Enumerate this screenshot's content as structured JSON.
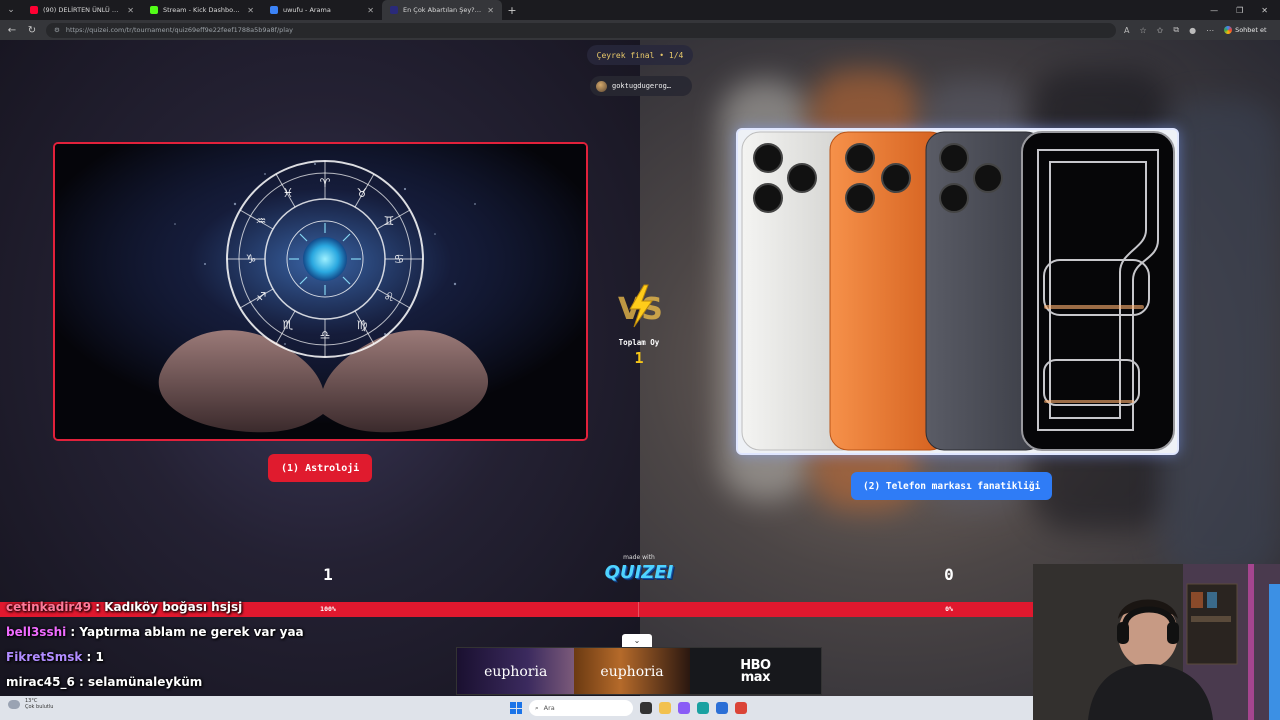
{
  "browser": {
    "tabs": [
      {
        "title": "(90) DELİRTEN ÜNLÜ BİLME OYUN",
        "favicon_color": "#ff0033",
        "active": false
      },
      {
        "title": "Stream - Kick Dashboard",
        "favicon_color": "#53fc18",
        "active": false
      },
      {
        "title": "uwufu - Arama",
        "favicon_color": "#3b82f6",
        "active": false
      },
      {
        "title": "En Çok Abartılan Şey?#2 - Tier Lis",
        "favicon_color": "#2a2a7a",
        "active": true
      }
    ],
    "url": "https://quizei.com/tr/tournament/quiz69eff9e22feef1788a5b9a8f/play",
    "chat_button": "Sohbet et"
  },
  "quiz": {
    "round_badge": "Çeyrek final • 1/4",
    "creator": "goktugdugerog…",
    "left_option": {
      "label": "(1) Astroloji",
      "score": "1",
      "percent": "100%",
      "ratio": 1.0
    },
    "right_option": {
      "label": "(2) Telefon markası fanatikliği",
      "score": "0",
      "percent": "0%",
      "ratio": 0.0
    },
    "vs_text": "VS",
    "total_label": "Toplam Oy",
    "total_value": "1",
    "made_with": "made with",
    "logo": "QUIZEI",
    "accent_left": "#e01b2e",
    "accent_right": "#2f7cf6"
  },
  "chat": [
    {
      "user": "cetinkadir49",
      "message": "Kadıköy boğası hsjsj",
      "color": "#ff7a9a"
    },
    {
      "user": "bell3sshi",
      "message": "Yaptırma ablam ne gerek var yaa",
      "color": "#f06bff"
    },
    {
      "user": "FikretSmsk",
      "message": "1",
      "color": "#b18cff"
    },
    {
      "user": "mirac45_6",
      "message": "selamünaleyküm",
      "color": "#ffffff"
    }
  ],
  "ad": {
    "p1": "euphoria",
    "p2": "euphoria",
    "p3_line1": "HBO",
    "p3_line2": "max"
  },
  "taskbar": {
    "temp": "13°C",
    "weather": "Çok bulutlu",
    "search_placeholder": "Ara"
  }
}
